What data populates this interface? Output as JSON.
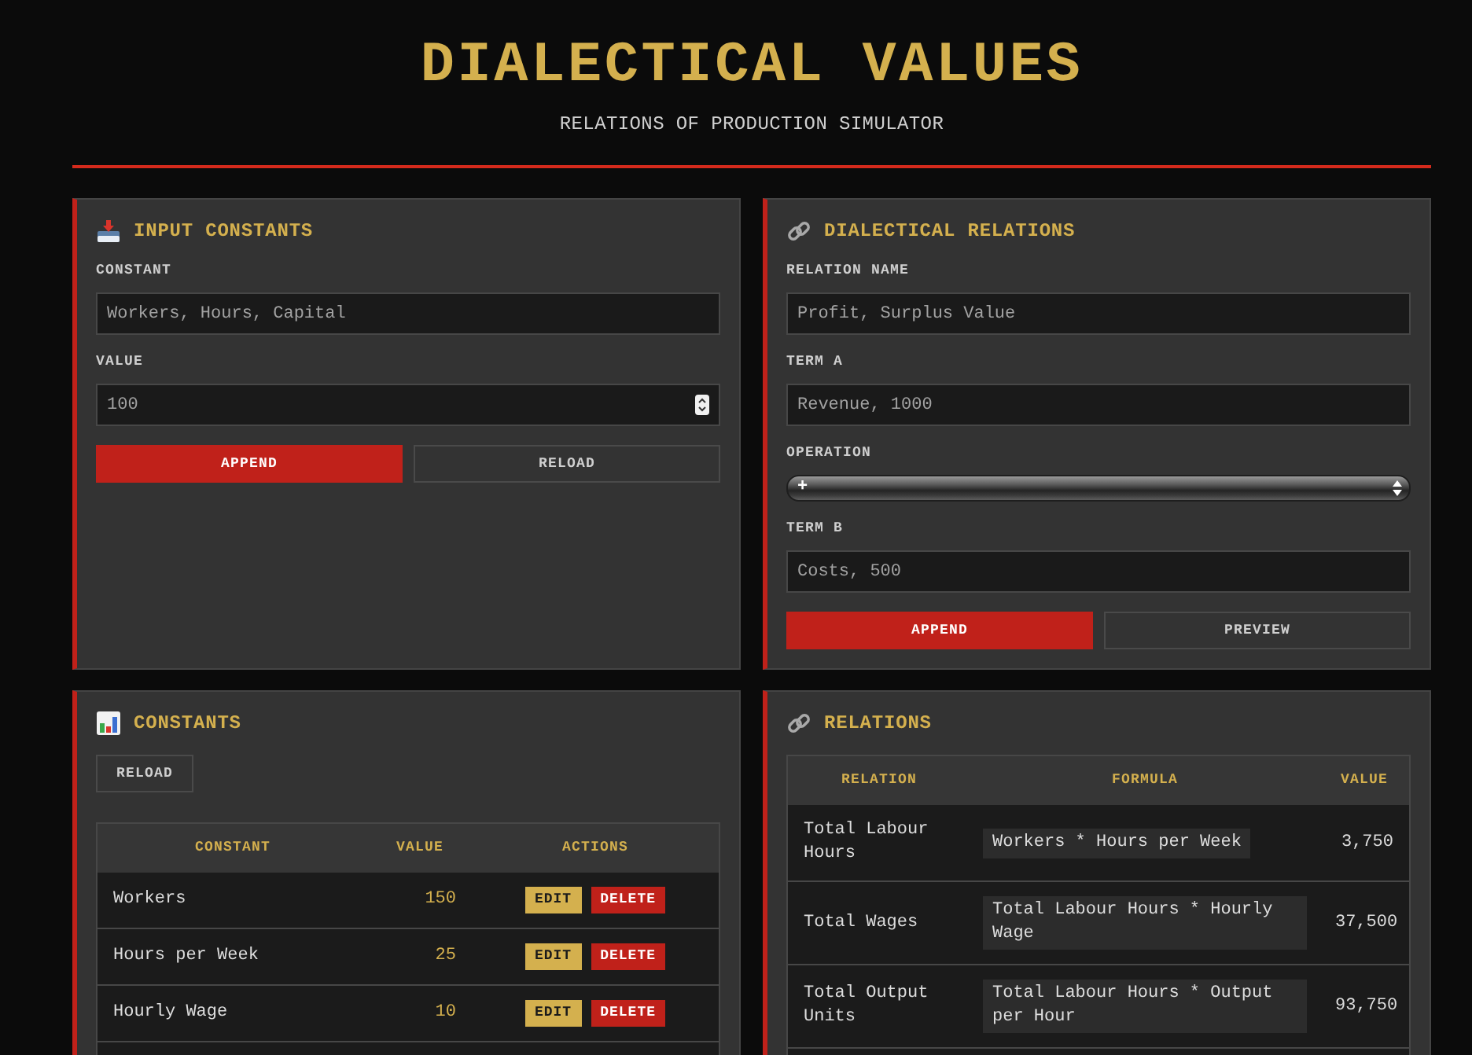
{
  "header": {
    "title": "DIALECTICAL VALUES",
    "subtitle": "RELATIONS OF PRODUCTION SIMULATOR"
  },
  "input_constants": {
    "title": "INPUT CONSTANTS",
    "fields": [
      {
        "kind": "text",
        "label": "CONSTANT",
        "placeholder": "Workers, Hours, Capital"
      },
      {
        "kind": "number",
        "label": "VALUE",
        "placeholder": "100"
      }
    ],
    "buttons": [
      {
        "kind": "primary",
        "label": "APPEND"
      },
      {
        "kind": "secondary",
        "label": "RELOAD"
      }
    ]
  },
  "dialectical_relations": {
    "title": "DIALECTICAL RELATIONS",
    "fields": [
      {
        "kind": "text",
        "label": "RELATION NAME",
        "placeholder": "Profit, Surplus Value"
      },
      {
        "kind": "text",
        "label": "TERM A",
        "placeholder": "Revenue, 1000"
      },
      {
        "kind": "select",
        "label": "OPERATION",
        "value": "+"
      },
      {
        "kind": "text",
        "label": "TERM B",
        "placeholder": "Costs, 500"
      }
    ],
    "buttons": [
      {
        "kind": "primary",
        "label": "APPEND"
      },
      {
        "kind": "secondary",
        "label": "PREVIEW"
      }
    ]
  },
  "constants": {
    "title": "CONSTANTS",
    "buttons": [
      {
        "kind": "secondary",
        "label": "RELOAD"
      }
    ],
    "table": {
      "columns": [
        "CONSTANT",
        "VALUE",
        "ACTIONS"
      ],
      "rows": [
        {
          "constant": "Workers",
          "value": "150",
          "actions": [
            {
              "kind": "edit",
              "label": "EDIT"
            },
            {
              "kind": "delete",
              "label": "DELETE"
            }
          ]
        },
        {
          "constant": "Hours per Week",
          "value": "25",
          "actions": [
            {
              "kind": "edit",
              "label": "EDIT"
            },
            {
              "kind": "delete",
              "label": "DELETE"
            }
          ]
        },
        {
          "constant": "Hourly Wage",
          "value": "10",
          "actions": [
            {
              "kind": "edit",
              "label": "EDIT"
            },
            {
              "kind": "delete",
              "label": "DELETE"
            }
          ]
        }
      ]
    }
  },
  "relations": {
    "title": "RELATIONS",
    "table": {
      "columns": [
        "RELATION",
        "FORMULA",
        "VALUE"
      ],
      "rows": [
        {
          "relation": "Total Labour Hours",
          "formula": "Workers * Hours per Week",
          "value": "3,750"
        },
        {
          "relation": "Total Wages",
          "formula": "Total Labour Hours * Hourly Wage",
          "value": "37,500"
        },
        {
          "relation": "Total Output Units",
          "formula": "Total Labour Hours * Output per Hour",
          "value": "93,750"
        }
      ]
    }
  }
}
